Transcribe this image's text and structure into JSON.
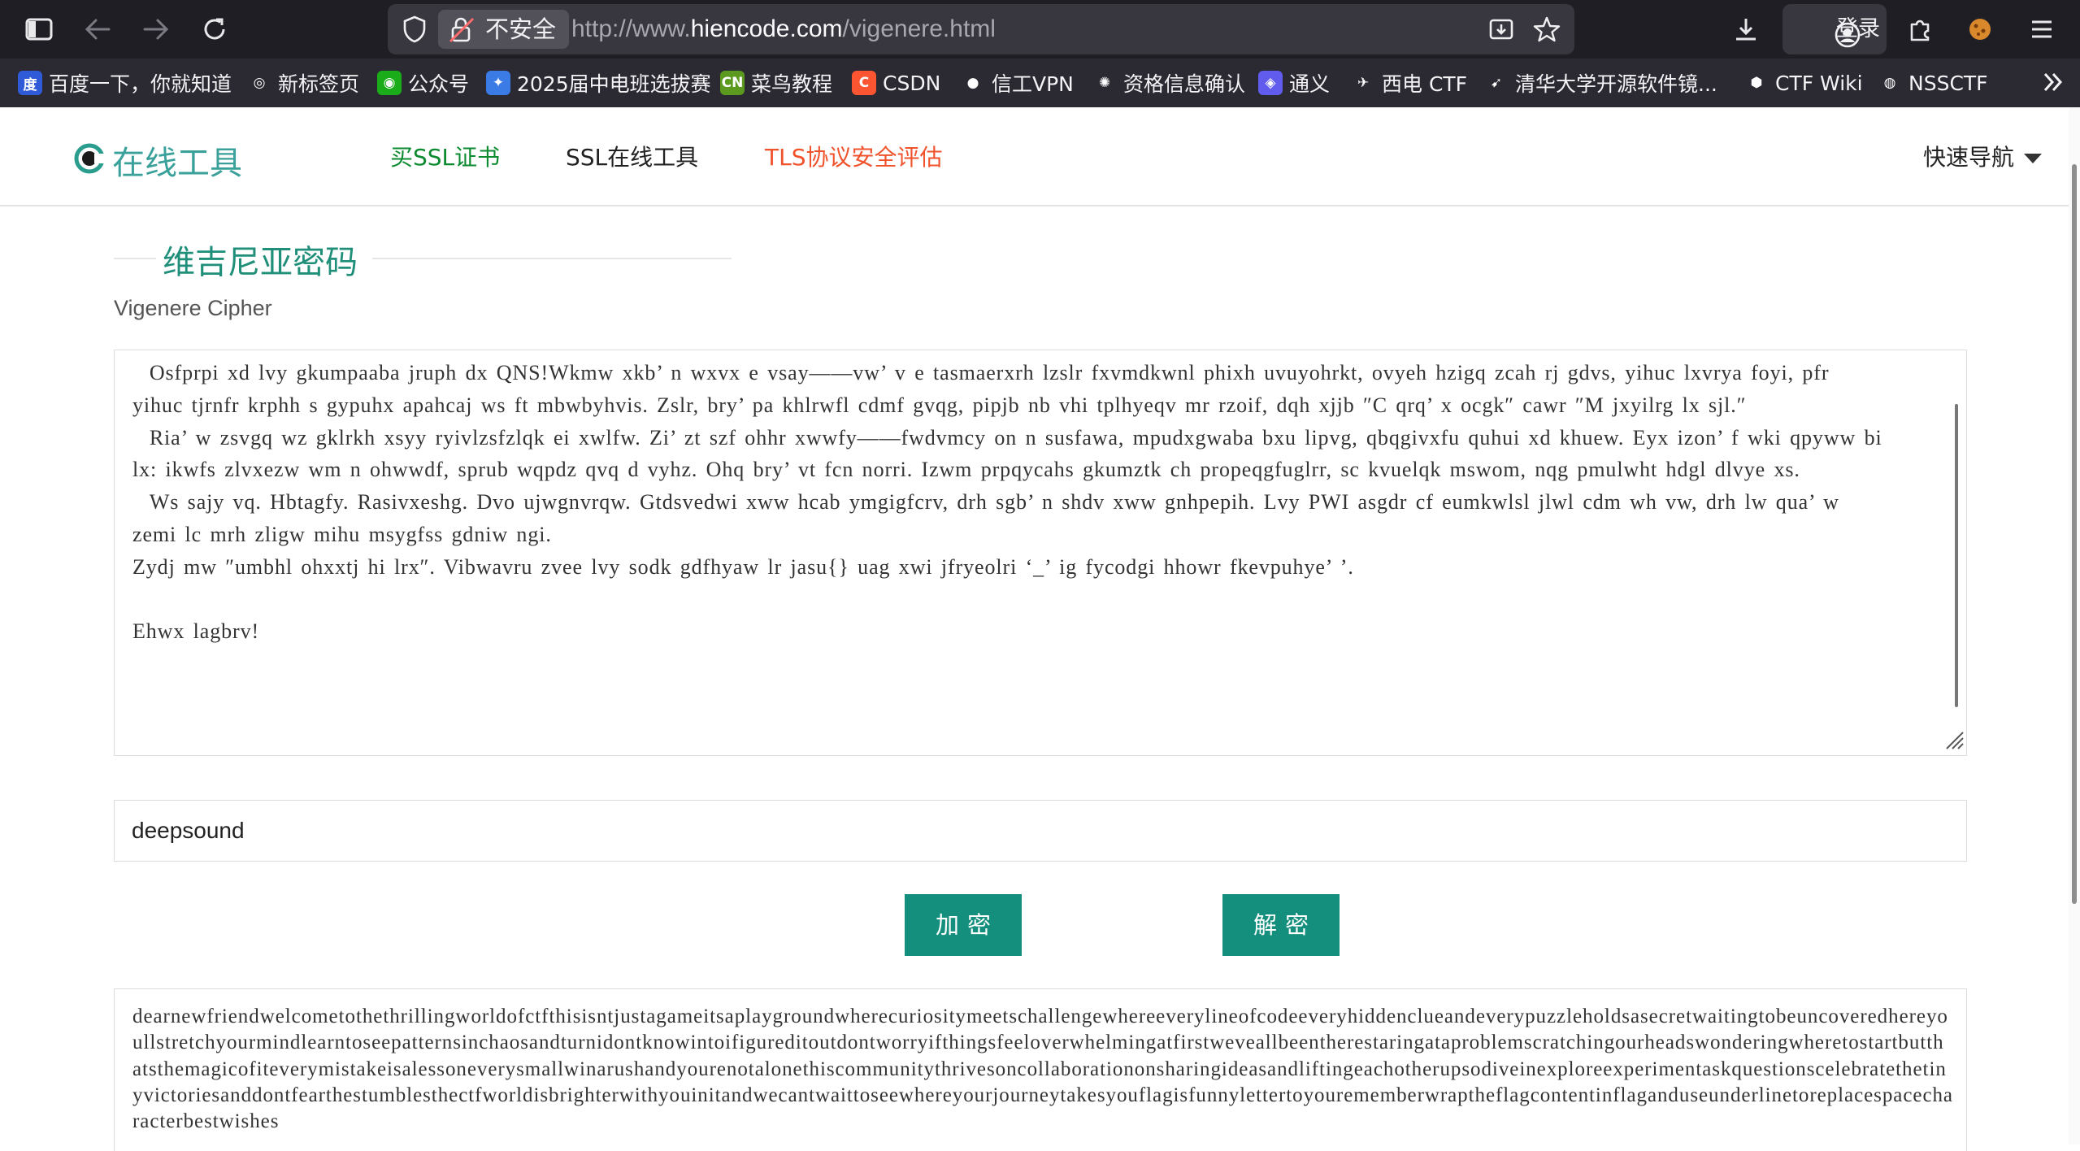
{
  "browser": {
    "url_prefix": "http://www.",
    "url_domain": "hiencode.com",
    "url_path": "/vigenere.html",
    "security_label": "不安全",
    "login_label": "登录"
  },
  "bookmarks": [
    {
      "label": "百度一下，你就知道",
      "icon": "baidu-icon",
      "color": "#2f5bd9",
      "glyph": "度"
    },
    {
      "label": "新标签页",
      "icon": "globe-icon",
      "color": "#2b2a33",
      "glyph": "◎"
    },
    {
      "label": "公众号",
      "icon": "wechat-icon",
      "color": "#1aad19",
      "glyph": "◉"
    },
    {
      "label": "2025届中电班选拔赛",
      "icon": "contest-icon",
      "color": "#3b7be5",
      "glyph": "✦"
    },
    {
      "label": "菜鸟教程",
      "icon": "runoob-icon",
      "color": "#5b9a1f",
      "glyph": "CN"
    },
    {
      "label": "CSDN",
      "icon": "csdn-icon",
      "color": "#fc5531",
      "glyph": "C"
    },
    {
      "label": "信工VPN",
      "icon": "vpn-icon",
      "color": "#2b2a33",
      "glyph": "●"
    },
    {
      "label": "资格信息确认",
      "icon": "settings-icon",
      "color": "#2b2a33",
      "glyph": "✺"
    },
    {
      "label": "通义",
      "icon": "tongyi-icon",
      "color": "#615ced",
      "glyph": "◈"
    },
    {
      "label": "西电 CTF",
      "icon": "ctf-icon",
      "color": "#2b2a33",
      "glyph": "✈"
    },
    {
      "label": "清华大学开源软件镜...",
      "icon": "tuna-icon",
      "color": "#2b2a33",
      "glyph": "➹"
    },
    {
      "label": "CTF Wiki",
      "icon": "ctfwiki-icon",
      "color": "#2b2a33",
      "glyph": "⬢"
    },
    {
      "label": "NSSCTF",
      "icon": "nssctf-icon",
      "color": "#2b2a33",
      "glyph": "◍"
    }
  ],
  "site": {
    "logo_text": "在线工具",
    "nav": [
      {
        "label": "买SSL证书",
        "color": "#0b8a2f"
      },
      {
        "label": "SSL在线工具",
        "color": "#222222"
      },
      {
        "label": "TLS协议安全评估",
        "color": "#f0522b"
      }
    ],
    "quick_nav": "快速导航"
  },
  "tool": {
    "title": "维吉尼亚密码",
    "subtitle": "Vigenere Cipher",
    "cipher_text": "  Osfprpi xd lvy gkumpaaba jruph dx QNS!Wkmw xkb’ n wxvx e vsay——vw’ v e tasmaerxrh lzslr fxvmdkwnl phixh uvuyohrkt, ovyeh hzigq zcah rj gdvs, yihuc lxvrya foyi, pfr yihuc tjrnfr krphh s gypuhx apahcaj ws ft mbwbyhvis. Zslr, bry’ pa khlrwfl cdmf gvqg, pipjb nb vhi tplhyeqv mr rzoif, dqh xjjb ″C qrq’ x ocgk″ cawr ″M jxyilrg lx sjl.″\n  Ria’ w zsvgq wz gklrkh xsyy ryivlzsfzlqk ei xwlfw. Zi’ zt szf ohhr xwwfy——fwdvmcy on n susfawa, mpudxgwaba bxu lipvg, qbqgivxfu quhui xd khuew. Eyx izon’ f wki qpyww bi lx: ikwfs zlvxezw wm n ohwwdf, sprub wqpdz qvq d vyhz. Ohq bry’ vt fcn norri. Izwm prpqycahs gkumztk ch propeqgfuglrr, sc kvuelqk mswom, nqg pmulwht hdgl dlvye xs.\n  Ws sajy vq. Hbtagfy. Rasivxeshg. Dvo ujwgnvrqw. Gtdsvedwi xww hcab ymgigfcrv, drh sgb’ n shdv xww gnhpepih. Lvy PWI asgdr cf eumkwlsl jlwl cdm wh vw, drh lw qua’ w zemi lc mrh zligw mihu msygfss gdniw ngi.\nZydj mw ″umbhl ohxxtj hi lrx″. Vibwavru zvee lvy sodk gdfhyaw lr jasu{} uag xwi jfryeolri ‘_’ ig fycodgi hhowr fkevpuhye’ ’.\n\nEhwx lagbrv!",
    "key_value": "deepsound",
    "encrypt_label": "加密",
    "decrypt_label": "解密",
    "result_text": "dearnewfriendwelcometothethrillingworldofctfthisisntjustagameitsaplaygroundwherecuriositymeetschallengewhereeverylineofcodeeveryhiddenclueandeverypuzzleholdsasecretwaitingtobeuncoveredhereyoullstretchyourmindlearntoseepatternsinchaosandturnidontknowintoifigureditoutdontworryifthingsfeeloverwhelmingatfirstweveallbeentherestaringataproblemscratchingourheadswonderingwheretostartbutthatsthemagicofiteverymistakeisalessoneverysmallwinarushandyourenotalonethiscommunitythrivesoncollaborationonsharingideasandliftingeachotherupsodiveinexploreexperimentaskquestionscelebratethetinyvictoriesanddontfearthestumblesthectfworldisbrighterwithyouinitandwecantwaittoseewhereyourjourneytakesyouflagisfunnylettertoyourememberwraptheflagcontentinflaganduseunderlinetoreplacespacecharacterbestwishes"
  }
}
